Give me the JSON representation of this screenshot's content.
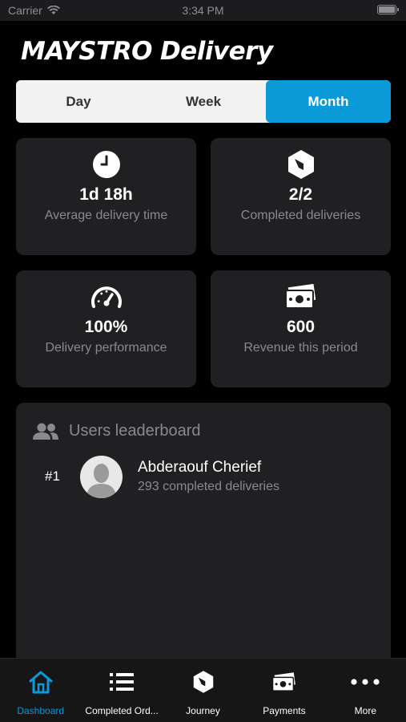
{
  "status_bar": {
    "carrier": "Carrier",
    "time": "3:34 PM"
  },
  "logo": {
    "brand": "MAYSTRO",
    "product": "Delivery"
  },
  "period_selector": {
    "options": [
      "Day",
      "Week",
      "Month"
    ],
    "selected": "Month"
  },
  "stats": [
    {
      "icon": "clock-icon",
      "value": "1d 18h",
      "label": "Average delivery time"
    },
    {
      "icon": "box-icon",
      "value": "2/2",
      "label": "Completed deliveries"
    },
    {
      "icon": "speedometer-icon",
      "value": "100%",
      "label": "Delivery performance"
    },
    {
      "icon": "money-icon",
      "value": "600",
      "label": "Revenue this period"
    }
  ],
  "leaderboard": {
    "title": "Users leaderboard",
    "entries": [
      {
        "rank": "#1",
        "name": "Abderaouf Cherief",
        "subtitle": "293 completed deliveries"
      }
    ]
  },
  "tabbar": {
    "items": [
      {
        "label": "Dashboard",
        "icon": "home-icon"
      },
      {
        "label": "Completed Ord...",
        "icon": "list-icon"
      },
      {
        "label": "Journey",
        "icon": "box-icon"
      },
      {
        "label": "Payments",
        "icon": "money-icon"
      },
      {
        "label": "More",
        "icon": "more-icon"
      }
    ],
    "selected": "Dashboard"
  },
  "colors": {
    "accent": "#0a9ad8",
    "card": "#202022",
    "background": "#000000",
    "muted_text": "#8a8a8e"
  }
}
